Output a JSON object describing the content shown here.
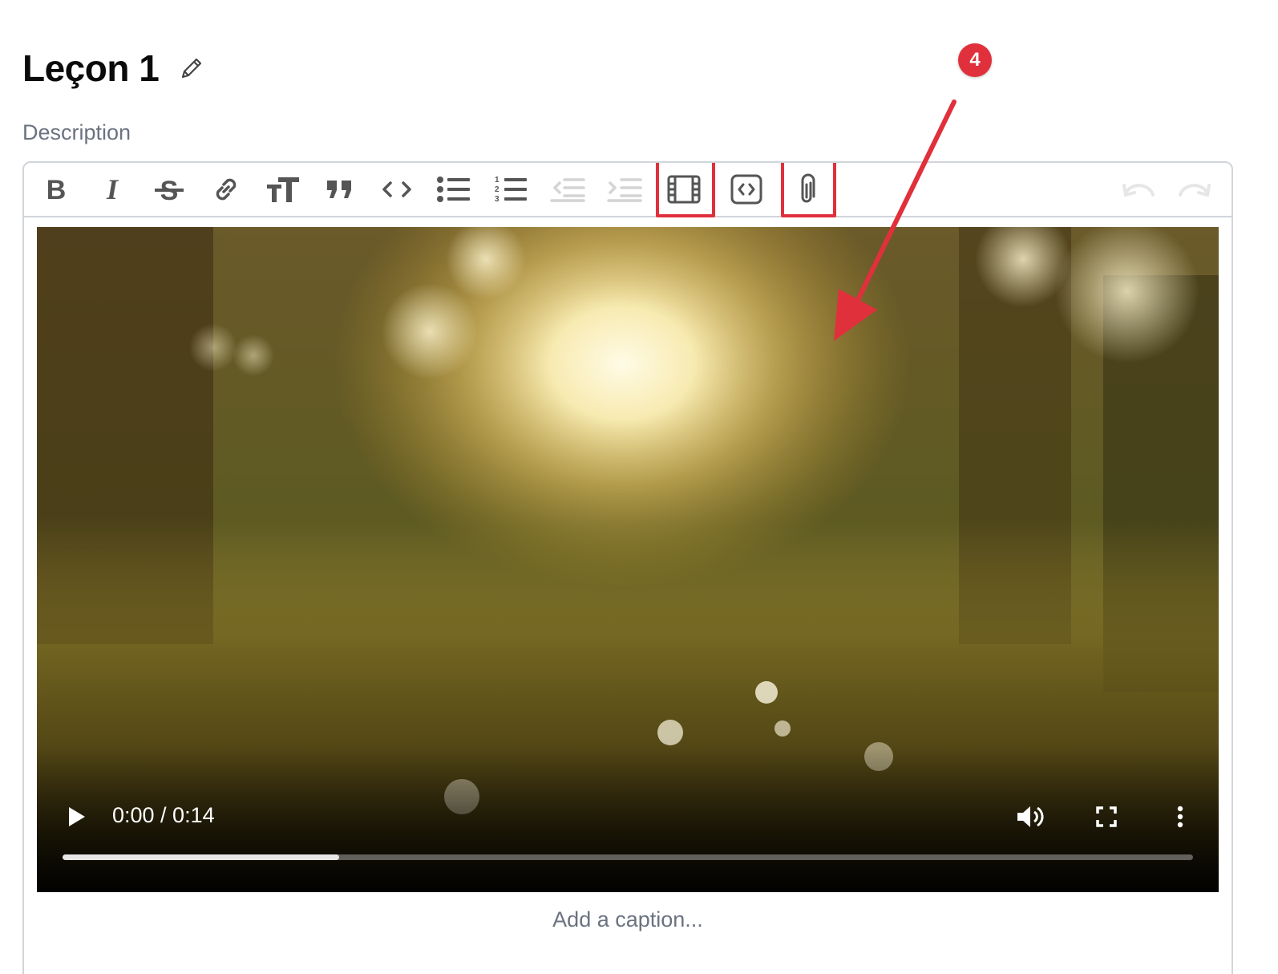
{
  "lesson": {
    "title": "Leçon 1",
    "description_label": "Description"
  },
  "toolbar": {
    "buttons": [
      "bold",
      "italic",
      "strikethrough",
      "link",
      "heading",
      "quote",
      "code",
      "bullet-list",
      "numbered-list",
      "decrease-indent",
      "increase-indent",
      "video",
      "embed",
      "attachment",
      "undo",
      "redo"
    ],
    "disabled": [
      "decrease-indent",
      "increase-indent",
      "undo",
      "redo"
    ],
    "highlighted": [
      "video",
      "attachment"
    ]
  },
  "video": {
    "time": "0:00 / 0:14",
    "progress_fraction": 0.245
  },
  "caption_placeholder": "Add a caption...",
  "annotation": {
    "step_number": "4"
  },
  "colors": {
    "highlight": "#e0303b",
    "label": "#6b7280",
    "border": "#d1d5db"
  }
}
